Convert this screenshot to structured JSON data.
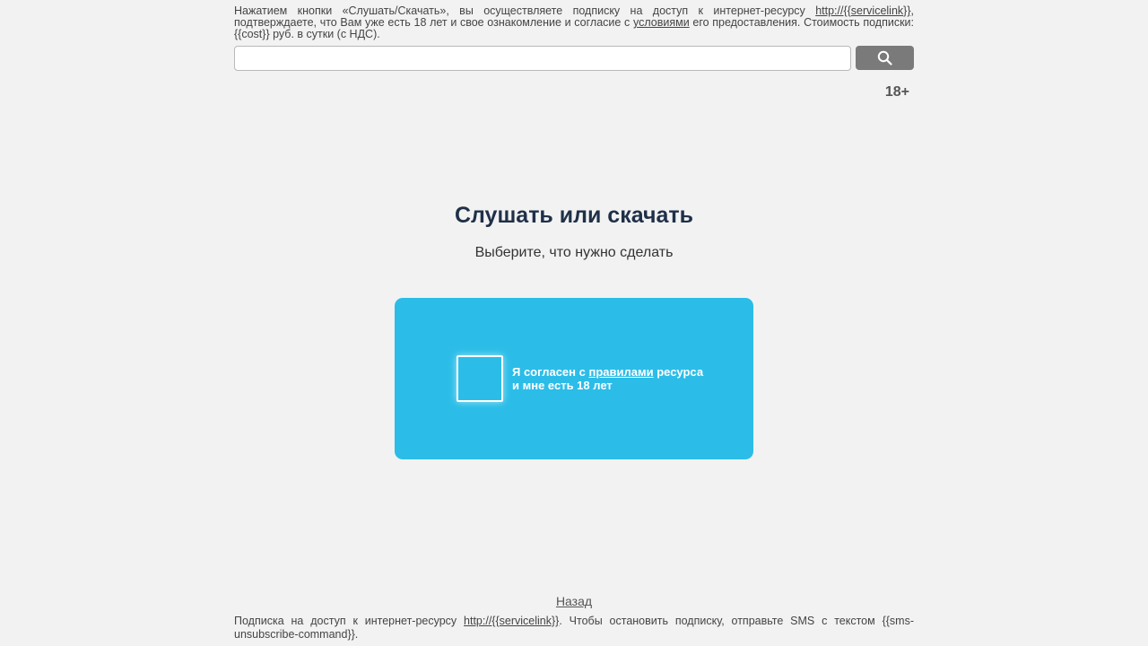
{
  "disclaimer": {
    "text_1": "Нажатием кнопки «Слушать/Скачать», вы осуществляете подписку на доступ к интернет-ресурсу ",
    "service_link": "http://{{servicelink}}",
    "text_2": ", подтверждаете, что Вам уже есть 18 лет и свое ознакомление и согласие с ",
    "terms_link": "условиями",
    "text_3": " его предоставления. Стоимость подписки: {{cost}} руб. в сутки (с НДС)."
  },
  "search": {
    "value": "",
    "placeholder": "",
    "button_icon": "search-icon"
  },
  "age_badge": "18+",
  "main": {
    "title": "Слушать или скачать",
    "subtitle": "Выберите, что нужно сделать"
  },
  "card": {
    "color": "#2bbde8",
    "checkbox_checked": false,
    "agree_text_1": "Я согласен с ",
    "rules_link": "правилами",
    "agree_text_2": " ресурса",
    "agree_text_3": "и мне есть 18 лет"
  },
  "back_link": "Назад",
  "footer": {
    "text_1": "Подписка на доступ к интернет-ресурсу ",
    "service_link": "http://{{servicelink}}",
    "text_2": ". Чтобы остановить подписку, отправьте SMS с текстом {{sms-unsubscribe-command}}."
  }
}
